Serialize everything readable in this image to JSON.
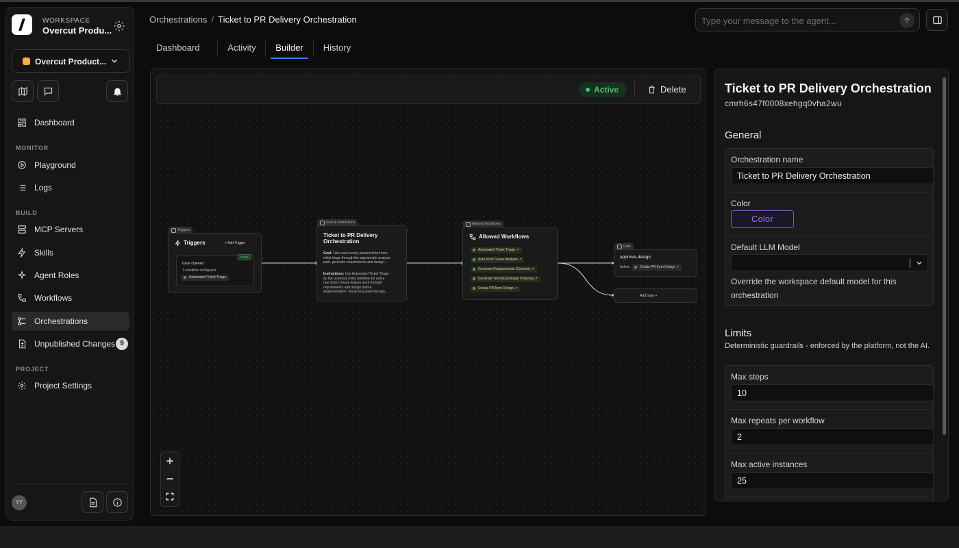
{
  "workspace": {
    "label": "WORKSPACE",
    "name": "Overcut Produ..."
  },
  "project": {
    "name": "Overcut Product...",
    "dot_color": "#f2b34a"
  },
  "sidebar": {
    "dashboard": "Dashboard",
    "sections": {
      "monitor": "MONITOR",
      "build": "BUILD",
      "project": "PROJECT"
    },
    "monitor_items": [
      "Playground",
      "Logs"
    ],
    "build_items": [
      "MCP Servers",
      "Skills",
      "Agent Roles",
      "Workflows",
      "Orchestrations",
      "Unpublished Changes"
    ],
    "unpublished_count": "9",
    "project_items": [
      "Project Settings"
    ],
    "avatar": "YY"
  },
  "breadcrumb": {
    "root": "Orchestrations",
    "separator": "/",
    "current": "Ticket to PR Delivery Orchestration"
  },
  "agent": {
    "placeholder": "Type your message to the agent..."
  },
  "tabs": [
    "Dashboard",
    "Activity",
    "Builder",
    "History"
  ],
  "toolbar": {
    "status": "Active",
    "delete": "Delete",
    "status_color": "#4ec072"
  },
  "flow": {
    "triggers": {
      "tag": "Triggers",
      "title": "Triggers",
      "add": "+ Add Trigger",
      "event_badge": "Issue",
      "event": "Issue Opened",
      "conditions": "1 condition configured",
      "workflow": "Automated Ticket Triage"
    },
    "goal": {
      "tag": "Goal & Instructions",
      "title_line1": "Ticket to PR Delivery",
      "title_line2": "Orchestration",
      "goal_label": "Goal:",
      "goal_lines": [
        " Take each newly opened ticket from",
        "initial triage through the appropriate analysis",
        "path, generate requirements and design..."
      ],
      "instr_label": "Instructions:",
      "instr_lines": [
        " Use Automated Ticket Triage",
        "as the universal entry workflow for every",
        "new ticket. Route feature work through",
        "requirements and design before",
        "implementation. Route bug work through..."
      ]
    },
    "workflows": {
      "tag": "Allowed Workflows",
      "title": "Allowed Workflows",
      "items": [
        "Automated Ticket Triage",
        "Auto Root Cause Analysis",
        "Generate Requirements (Concise)",
        "Generate Technical Design Proposal",
        "Create PR from Design"
      ]
    },
    "gate": {
      "tag": "Gate",
      "name": "approve-design",
      "before": "before",
      "target": "Create PR from Design",
      "add": "Add Gate +"
    }
  },
  "details": {
    "title": "Ticket to PR Delivery Orchestration",
    "id": "cmrh6s47f0008xehgq0vha2wu",
    "general_heading": "General",
    "name_label": "Orchestration name",
    "name_value": "Ticket to PR Delivery Orchestration",
    "color_label": "Color",
    "color_button": "Color",
    "llm_label": "Default LLM Model",
    "llm_help": "Override the workspace default model for this orchestration",
    "limits_heading": "Limits",
    "limits_sub": "Deterministic guardrails - enforced by the platform, not the AI.",
    "max_steps_label": "Max steps",
    "max_steps": "10",
    "max_repeats_label": "Max repeats per workflow",
    "max_repeats": "2",
    "max_instances_label": "Max active instances",
    "max_instances": "25"
  }
}
